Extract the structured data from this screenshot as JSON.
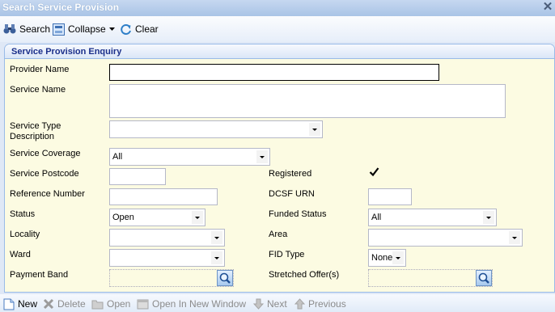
{
  "window": {
    "title": "Search Service Provision"
  },
  "toolbar": {
    "search": "Search",
    "collapse": "Collapse",
    "clear": "Clear"
  },
  "panel": {
    "title": "Service Provision Enquiry"
  },
  "form": {
    "provider_name": {
      "label": "Provider Name",
      "value": ""
    },
    "service_name": {
      "label": "Service Name",
      "value": ""
    },
    "service_type_description": {
      "label_line1": "Service Type",
      "label_line2": "Description",
      "value": ""
    },
    "service_coverage": {
      "label": "Service Coverage",
      "value": "All"
    },
    "service_postcode": {
      "label": "Service Postcode",
      "value": ""
    },
    "registered": {
      "label": "Registered",
      "checked": true
    },
    "reference_number": {
      "label": "Reference Number",
      "value": ""
    },
    "dcsf_urn": {
      "label": "DCSF URN",
      "value": ""
    },
    "status": {
      "label": "Status",
      "value": "Open"
    },
    "funded_status": {
      "label": "Funded Status",
      "value": "All"
    },
    "locality": {
      "label": "Locality",
      "value": ""
    },
    "area": {
      "label": "Area",
      "value": ""
    },
    "ward": {
      "label": "Ward",
      "value": ""
    },
    "fid_type": {
      "label": "FID Type",
      "value": "None"
    },
    "payment_band": {
      "label": "Payment Band",
      "value": ""
    },
    "stretched_offers": {
      "label": "Stretched Offer(s)",
      "value": ""
    }
  },
  "bottombar": {
    "new": "New",
    "delete": "Delete",
    "open": "Open",
    "open_new_window": "Open In New Window",
    "next": "Next",
    "previous": "Previous"
  }
}
